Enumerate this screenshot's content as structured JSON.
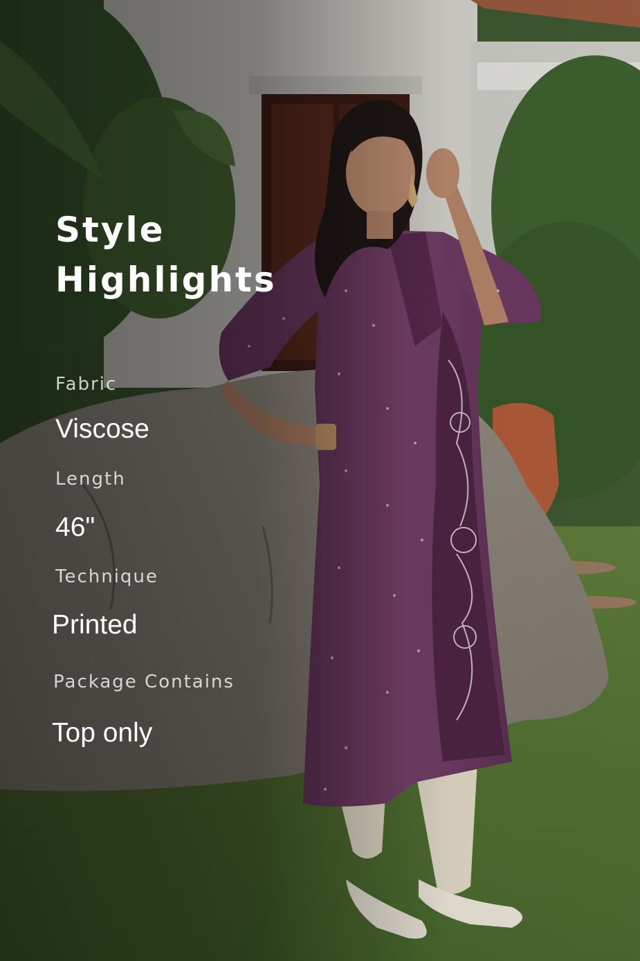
{
  "heading": {
    "line1": "Style",
    "line2": "Highlights"
  },
  "specs": [
    {
      "label": "Fabric",
      "value": "Viscose"
    },
    {
      "label": "Length",
      "value": "46\""
    },
    {
      "label": "Technique",
      "value": "Printed"
    },
    {
      "label": "Package Contains",
      "value": "Top only"
    }
  ],
  "colors": {
    "kurta": "#6f3a62",
    "pants": "#e6dfcc",
    "grass": "#5a7a3a",
    "rock": "#8a8278",
    "wall": "#d9d8d2"
  }
}
